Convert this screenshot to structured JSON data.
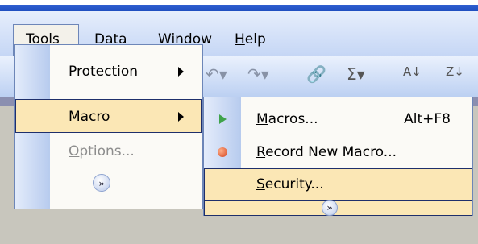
{
  "menubar": {
    "tools": {
      "key": "T",
      "rest": "ools"
    },
    "data": {
      "key": "D",
      "rest": "ata"
    },
    "window": {
      "key": "W",
      "rest": "indow"
    },
    "help": {
      "key": "H",
      "rest": "elp"
    }
  },
  "toolbar": {
    "sigma": "Σ",
    "sort_asc": "A↓",
    "sort_desc": "Z↓"
  },
  "tools_menu": {
    "protection": {
      "key": "P",
      "rest": "rotection"
    },
    "macro": {
      "key": "M",
      "rest": "acro"
    },
    "options": {
      "key": "O",
      "rest": "ptions..."
    },
    "expand_glyph": "»"
  },
  "macro_menu": {
    "macros": {
      "key": "M",
      "rest": "acros...",
      "shortcut": "Alt+F8"
    },
    "record": {
      "key": "R",
      "rest": "ecord New Macro..."
    },
    "security": {
      "key": "S",
      "rest": "ecurity..."
    },
    "expand_glyph": "»"
  },
  "colors": {
    "highlight": "#fbe7b5",
    "highlight_border": "#1e2f6b",
    "menu_gutter": "#b7cbee",
    "record_red": "#d4421c",
    "play_green": "#3fa34a"
  }
}
